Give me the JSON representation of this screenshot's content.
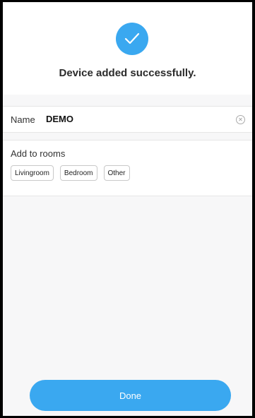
{
  "header": {
    "icon": "check-circle-icon",
    "title": "Device added successfully."
  },
  "name_field": {
    "label": "Name",
    "value": "DEMO",
    "clear_icon": "clear-icon"
  },
  "rooms": {
    "title": "Add to rooms",
    "items": [
      {
        "label": "Livingroom"
      },
      {
        "label": "Bedroom"
      },
      {
        "label": "Other"
      }
    ]
  },
  "actions": {
    "done_label": "Done"
  },
  "colors": {
    "accent": "#3aa8f0",
    "background": "#f7f7f8"
  }
}
